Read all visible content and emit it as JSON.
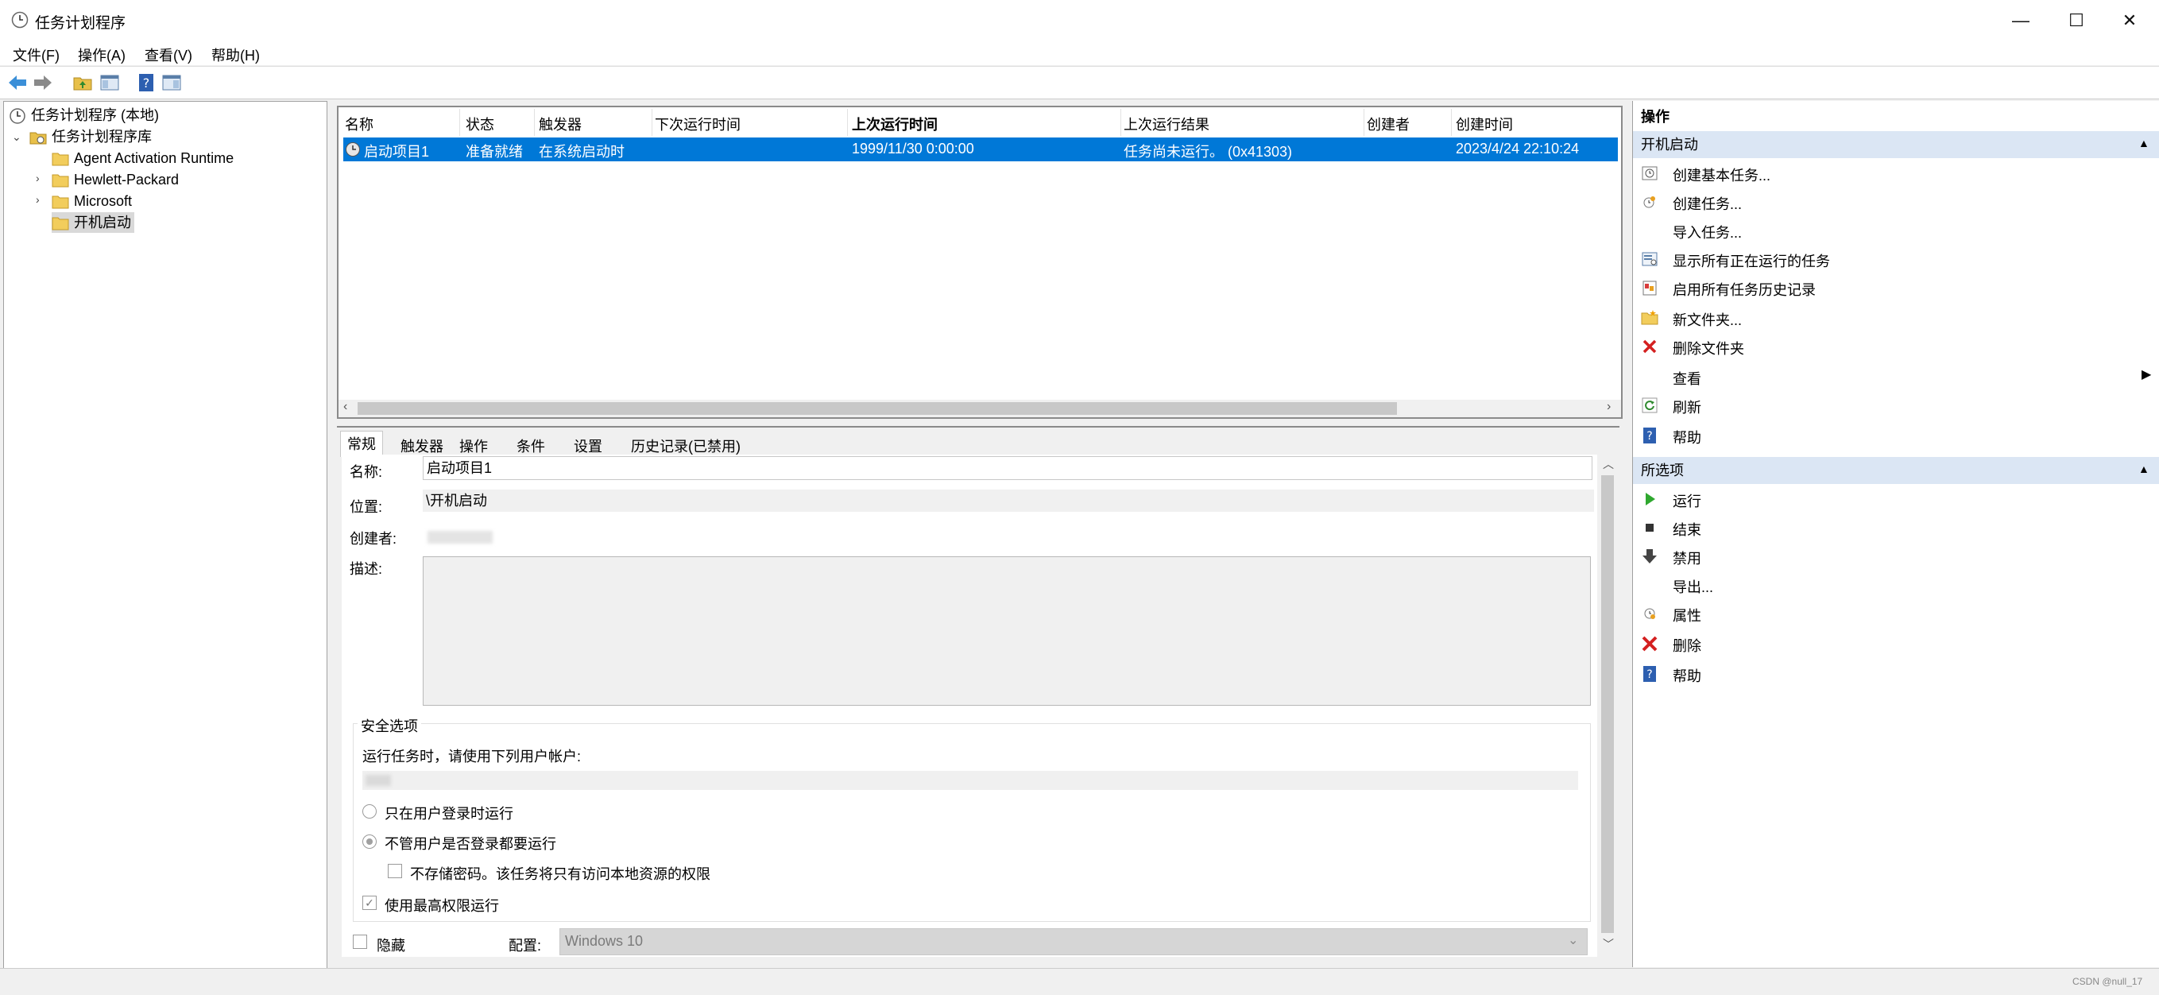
{
  "window": {
    "title": "任务计划程序",
    "minimize": "—",
    "maximize": "☐",
    "close": "✕"
  },
  "menu": [
    "文件(F)",
    "操作(A)",
    "查看(V)",
    "帮助(H)"
  ],
  "tree": {
    "root": "任务计划程序 (本地)",
    "library": "任务计划程序库",
    "folders": [
      "Agent Activation Runtime",
      "Hewlett-Packard",
      "Microsoft",
      "开机启动"
    ]
  },
  "list": {
    "columns": [
      "名称",
      "状态",
      "触发器",
      "下次运行时间",
      "上次运行时间",
      "上次运行结果",
      "创建者",
      "创建时间"
    ],
    "rows": [
      {
        "name": "启动项目1",
        "status": "准备就绪",
        "trigger": "在系统启动时",
        "next_run": "",
        "last_run": "1999/11/30 0:00:00",
        "last_result": "任务尚未运行。 (0x41303)",
        "author": "",
        "created": "2023/4/24 22:10:24"
      }
    ]
  },
  "details": {
    "tabs": [
      "常规",
      "触发器",
      "操作",
      "条件",
      "设置",
      "历史记录(已禁用)"
    ],
    "name_label": "名称:",
    "name_value": "启动项目1",
    "location_label": "位置:",
    "location_value": "\\开机启动",
    "author_label": "创建者:",
    "description_label": "描述:",
    "security_title": "安全选项",
    "run_as_label": "运行任务时，请使用下列用户帐户:",
    "radio_logged_on": "只在用户登录时运行",
    "radio_always": "不管用户是否登录都要运行",
    "no_store_password": "不存储密码。该任务将只有访问本地资源的权限",
    "highest_privileges": "使用最高权限运行",
    "hidden_label": "隐藏",
    "config_label": "配置:",
    "config_value": "Windows 10"
  },
  "actions": {
    "header": "操作",
    "section1_title": "开机启动",
    "section1_items": [
      "创建基本任务...",
      "创建任务...",
      "导入任务...",
      "显示所有正在运行的任务",
      "启用所有任务历史记录",
      "新文件夹...",
      "删除文件夹",
      "查看",
      "刷新",
      "帮助"
    ],
    "section2_title": "所选项",
    "section2_items": [
      "运行",
      "结束",
      "禁用",
      "导出...",
      "属性",
      "删除",
      "帮助"
    ]
  },
  "status_bar": {
    "watermark": "CSDN @null_17"
  }
}
